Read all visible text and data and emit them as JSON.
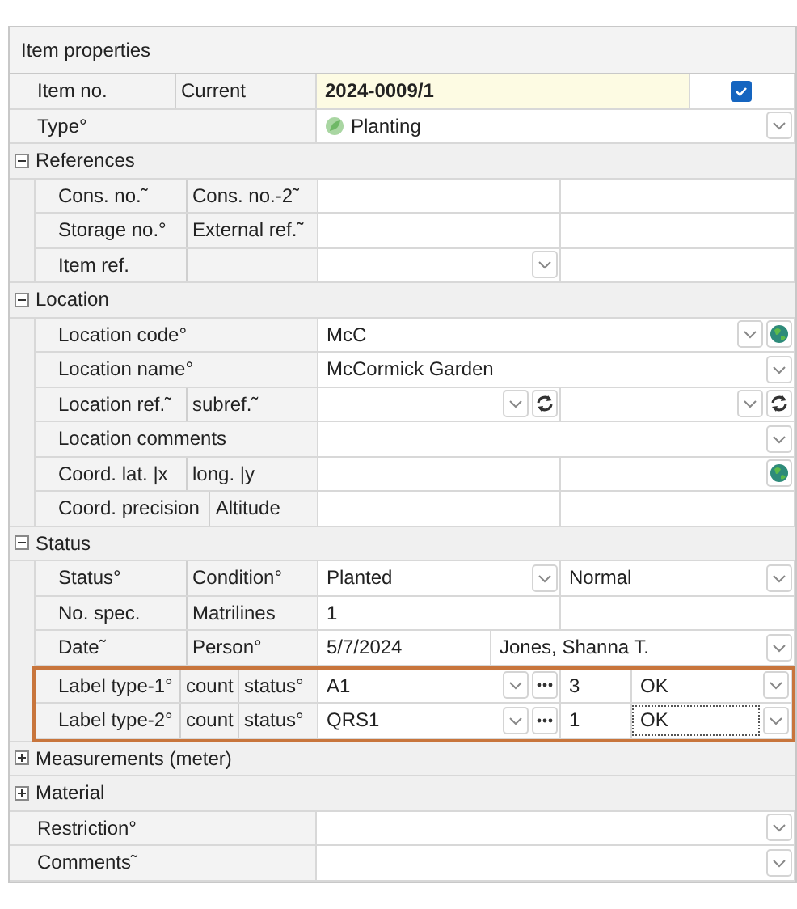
{
  "panel": {
    "title": "Item properties"
  },
  "rows": [
    {
      "kind": "field",
      "labels": [
        "Item no.",
        "Current"
      ],
      "cells": [
        {
          "kind": "wide",
          "text": "2024-0009/1",
          "emphasis": true
        },
        {
          "kind": "check",
          "checked": true
        }
      ]
    },
    {
      "kind": "field",
      "labels": [
        "Type°"
      ],
      "cells": [
        {
          "kind": "wide",
          "text": "Planting",
          "icon": true,
          "dropdown": true
        }
      ]
    },
    {
      "kind": "section",
      "title": "References",
      "expanded": true,
      "children": [
        {
          "kind": "field",
          "labels": [
            "Cons. no.˜",
            "Cons. no.-2˜"
          ],
          "cells": [
            {
              "kind": "half"
            },
            {
              "kind": "wide"
            }
          ]
        },
        {
          "kind": "field",
          "labels": [
            "Storage no.°",
            "External ref.˜"
          ],
          "cells": [
            {
              "kind": "half"
            },
            {
              "kind": "wide"
            }
          ]
        },
        {
          "kind": "field",
          "labels": [
            "Item ref."
          ],
          "blank_sublabel": true,
          "cells": [
            {
              "kind": "half",
              "dropdown": true
            },
            {
              "kind": "wide"
            }
          ]
        }
      ]
    },
    {
      "kind": "section",
      "title": "Location",
      "expanded": true,
      "children": [
        {
          "kind": "field",
          "labels": [
            "Location code°"
          ],
          "cells": [
            {
              "kind": "wide",
              "text": "McC",
              "dropdown": true,
              "globe": true
            }
          ]
        },
        {
          "kind": "field",
          "labels": [
            "Location name°"
          ],
          "cells": [
            {
              "kind": "wide",
              "text": "McCormick Garden",
              "dropdown": true
            }
          ]
        },
        {
          "kind": "field",
          "labels": [
            "Location ref.˜",
            "subref.˜"
          ],
          "cells": [
            {
              "kind": "half",
              "dropdown": true,
              "refresh": true
            },
            {
              "kind": "wide",
              "dropdown": true,
              "refresh": true
            }
          ]
        },
        {
          "kind": "field",
          "labels": [
            "Location comments"
          ],
          "cells": [
            {
              "kind": "wide",
              "dropdown": true
            }
          ]
        },
        {
          "kind": "field",
          "labels": [
            "Coord. lat. |x",
            "long. |y"
          ],
          "cells": [
            {
              "kind": "half"
            },
            {
              "kind": "wide",
              "globe": true
            }
          ]
        },
        {
          "kind": "field",
          "labels": [
            "Coord. precision",
            "Altitude"
          ],
          "cells": [
            {
              "kind": "half"
            },
            {
              "kind": "wide"
            }
          ]
        }
      ]
    },
    {
      "kind": "section",
      "title": "Status",
      "expanded": true,
      "children": [
        {
          "kind": "field",
          "labels": [
            "Status°",
            "Condition°"
          ],
          "cells": [
            {
              "kind": "half",
              "text": "Planted",
              "dropdown": true
            },
            {
              "kind": "wide",
              "text": "Normal",
              "dropdown": true
            }
          ]
        },
        {
          "kind": "field",
          "labels": [
            "No. spec.",
            "Matrilines"
          ],
          "cells": [
            {
              "kind": "half",
              "text": "1"
            },
            {
              "kind": "wide"
            }
          ]
        },
        {
          "kind": "field",
          "labels": [
            "Date˜",
            "Person°"
          ],
          "cells": [
            {
              "kind": "short",
              "text": "5/7/2024"
            },
            {
              "kind": "wide",
              "text": "Jones, Shanna T.",
              "dropdown": true
            }
          ]
        },
        {
          "kind": "group",
          "highlighted": true,
          "rows": [
            {
              "kind": "field",
              "labels": [
                "Label type-1°",
                "count",
                "status°"
              ],
              "cells": [
                {
                  "kind": "half",
                  "text": "A1",
                  "dropdown": true,
                  "ellipsis": true
                },
                {
                  "kind": "narrow",
                  "text": "3"
                },
                {
                  "kind": "wide",
                  "text": "OK",
                  "dropdown": true
                }
              ]
            },
            {
              "kind": "field",
              "labels": [
                "Label type-2°",
                "count",
                "status°"
              ],
              "cells": [
                {
                  "kind": "half",
                  "text": "QRS1",
                  "dropdown": true,
                  "ellipsis": true
                },
                {
                  "kind": "narrow",
                  "text": "1"
                },
                {
                  "kind": "wide",
                  "text": "OK",
                  "focused": true,
                  "dropdown": true
                }
              ]
            }
          ]
        }
      ]
    },
    {
      "kind": "section",
      "title": "Measurements (meter)",
      "expanded": false
    },
    {
      "kind": "section",
      "title": "Material",
      "expanded": false
    },
    {
      "kind": "field",
      "labels": [
        "Restriction°"
      ],
      "cells": [
        {
          "kind": "wide",
          "dropdown": true
        }
      ]
    },
    {
      "kind": "field",
      "labels": [
        "Comments˜"
      ],
      "cells": [
        {
          "kind": "wide",
          "dropdown": true
        }
      ]
    }
  ]
}
